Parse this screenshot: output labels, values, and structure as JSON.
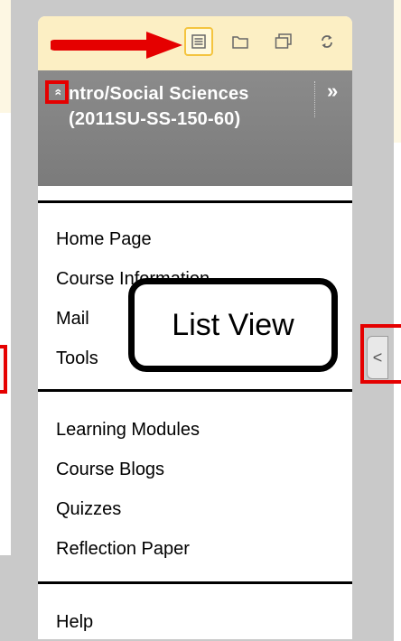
{
  "toolbar": {
    "buttons": [
      {
        "icon": "list-view-icon",
        "active": true
      },
      {
        "icon": "folder-view-icon",
        "active": false
      },
      {
        "icon": "windows-view-icon",
        "active": false
      },
      {
        "icon": "refresh-icon",
        "active": false
      }
    ]
  },
  "course": {
    "title": "ntro/Social Sciences (2011SU-SS-150-60)",
    "collapse_icon": "»",
    "expand_icon": "»"
  },
  "menu": {
    "group1": [
      "Home Page",
      "Course Information",
      "Mail",
      "Tools"
    ],
    "group2": [
      "Learning Modules",
      "Course Blogs",
      "Quizzes",
      "Reflection Paper"
    ],
    "group3": [
      "Help"
    ]
  },
  "callout": {
    "text": "List View"
  },
  "side_handle": {
    "icon": "<"
  },
  "colors": {
    "highlight_red": "#e50000",
    "toolbar_bg": "#fcefc4",
    "header_bg": "#808080",
    "arrow_red": "#e50000"
  }
}
